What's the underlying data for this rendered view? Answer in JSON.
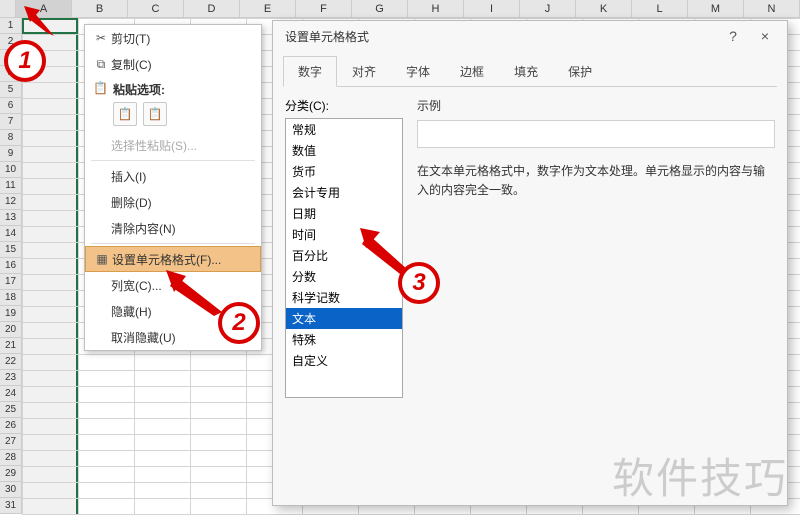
{
  "columns": [
    "A",
    "B",
    "C",
    "D",
    "E",
    "F",
    "G",
    "H",
    "I",
    "J",
    "K",
    "L",
    "M",
    "N"
  ],
  "rows": 31,
  "context_menu": {
    "cut": "剪切(T)",
    "copy": "复制(C)",
    "paste_header": "粘贴选项:",
    "paste_special": "选择性粘贴(S)...",
    "insert": "插入(I)",
    "delete": "删除(D)",
    "clear": "清除内容(N)",
    "format_cells": "设置单元格格式(F)...",
    "col_width": "列宽(C)...",
    "hide": "隐藏(H)",
    "unhide": "取消隐藏(U)"
  },
  "dialog": {
    "title": "设置单元格格式",
    "help": "?",
    "close": "×",
    "tabs": [
      "数字",
      "对齐",
      "字体",
      "边框",
      "填充",
      "保护"
    ],
    "category_label": "分类(C):",
    "categories": [
      "常规",
      "数值",
      "货币",
      "会计专用",
      "日期",
      "时间",
      "百分比",
      "分数",
      "科学记数",
      "文本",
      "特殊",
      "自定义"
    ],
    "selected_category": "文本",
    "sample_label": "示例",
    "description": "在文本单元格格式中，数字作为文本处理。单元格显示的内容与输入的内容完全一致。"
  },
  "callouts": {
    "c1": "1",
    "c2": "2",
    "c3": "3"
  },
  "watermark": "软件技巧"
}
